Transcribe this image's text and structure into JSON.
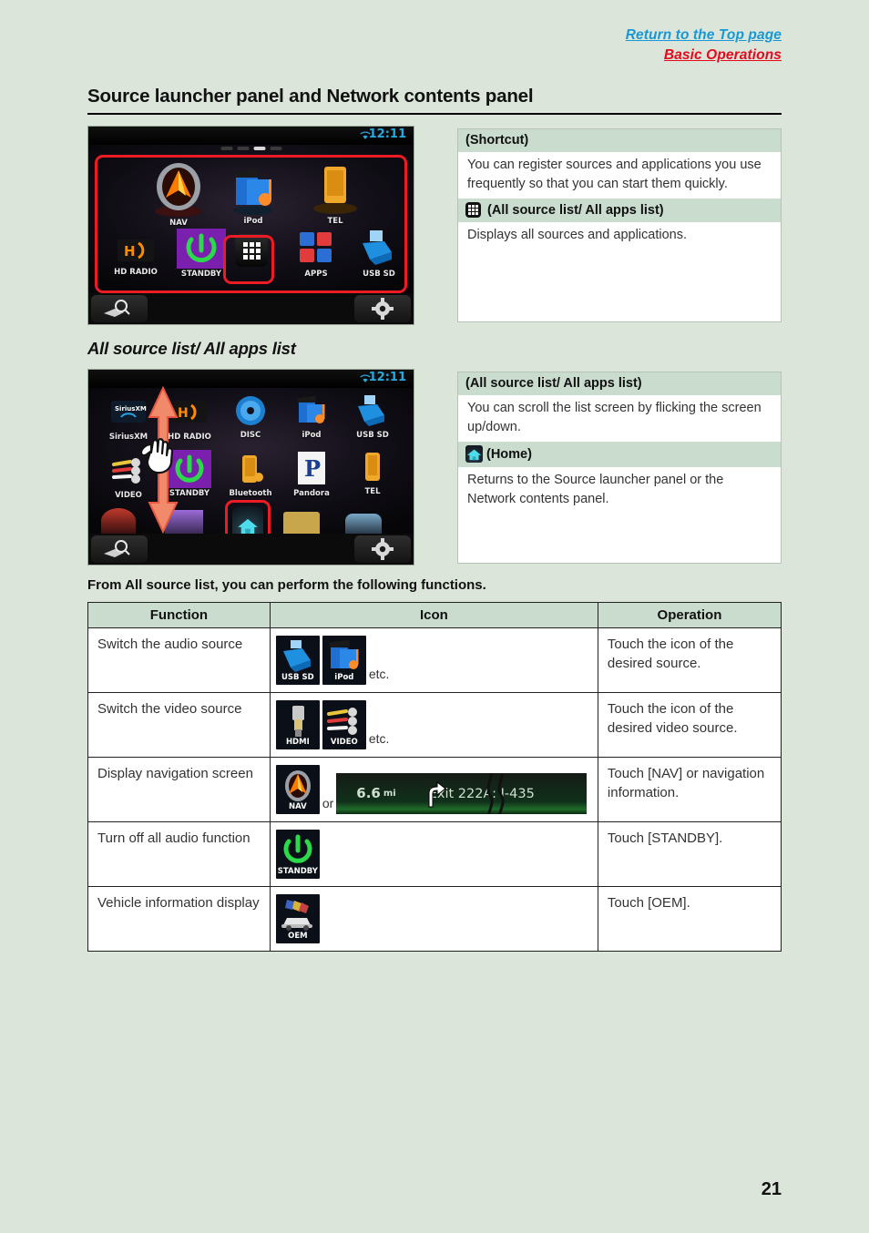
{
  "top_links": {
    "return": "Return to the Top page",
    "section": "Basic Operations",
    "return_color": "#1898d5",
    "section_color": "#e8071b"
  },
  "headings": {
    "main": "Source launcher panel and Network contents panel",
    "sub": "All source list/ All apps list",
    "table_intro": "From All source list, you can perform the following functions."
  },
  "device_launcher": {
    "clock": "12:11",
    "icons_row1": [
      {
        "label": "NAV",
        "icon": "nav-icon"
      },
      {
        "label": "iPod",
        "icon": "ipod-icon"
      },
      {
        "label": "TEL",
        "icon": "tel-icon"
      }
    ],
    "icons_row2": [
      {
        "label": "HD RADIO",
        "icon": "hd-radio-icon"
      },
      {
        "label": "STANDBY",
        "icon": "standby-icon"
      },
      {
        "label": "",
        "icon": "all-apps-grid-icon"
      },
      {
        "label": "APPS",
        "icon": "apps-icon"
      },
      {
        "label": "USB SD",
        "icon": "usb-sd-icon"
      }
    ],
    "bottom_left_icon": "map-search-icon",
    "bottom_right_icon": "gear-icon"
  },
  "device_allsource": {
    "clock": "12:11",
    "icons_row1": [
      {
        "label": "SiriusXM",
        "icon": "siriusxm-icon"
      },
      {
        "label": "HD RADIO",
        "icon": "hd-radio-icon"
      },
      {
        "label": "DISC",
        "icon": "disc-icon"
      },
      {
        "label": "iPod",
        "icon": "ipod-icon"
      },
      {
        "label": "USB SD",
        "icon": "usb-sd-icon"
      }
    ],
    "icons_row2": [
      {
        "label": "VIDEO",
        "icon": "video-icon"
      },
      {
        "label": "STANDBY",
        "icon": "standby-icon"
      },
      {
        "label": "Bluetooth",
        "icon": "bluetooth-icon"
      },
      {
        "label": "Pandora",
        "icon": "pandora-icon"
      },
      {
        "label": "TEL",
        "icon": "tel-icon"
      }
    ],
    "home_icon": "home-icon",
    "bottom_left_icon": "map-search-icon",
    "bottom_right_icon": "gear-icon"
  },
  "panel_shortcut": {
    "title": "(Shortcut)",
    "text": "You can register sources and applications you use frequently so that you can start them quickly.",
    "sub_title": "(All source list/ All apps list)",
    "sub_icon": "all-apps-grid-icon",
    "sub_text": "Displays all sources and applications."
  },
  "panel_allsource": {
    "title": " (All source list/ All apps list)",
    "text": "You can scroll the list screen by flicking the screen up/down.",
    "sub_title": "(Home)",
    "sub_icon": "home-icon",
    "sub_text": "Returns to the Source launcher panel or the Network contents panel."
  },
  "table": {
    "headers": [
      "Function",
      "Icon",
      "Operation"
    ],
    "rows": [
      {
        "function": "Switch the audio source",
        "icons": [
          {
            "label": "USB SD",
            "icon": "usb-sd-icon"
          },
          {
            "label": "iPod",
            "icon": "ipod-icon"
          }
        ],
        "etc": "etc.",
        "operation": "Touch the icon of the desired source."
      },
      {
        "function": "Switch the video source",
        "icons": [
          {
            "label": "HDMI",
            "icon": "hdmi-icon"
          },
          {
            "label": "VIDEO",
            "icon": "video-icon"
          }
        ],
        "etc": "etc.",
        "operation": "Touch the icon of the desired video source."
      },
      {
        "function": "Display navigation screen",
        "icons": [
          {
            "label": "NAV",
            "icon": "nav-icon"
          }
        ],
        "etc": "or",
        "nav_strip": {
          "distance": "6.6",
          "unit": "mi",
          "exit": "Exit 222A: I-435",
          "turn_icon": "turn-right-arrow-icon"
        },
        "operation": "Touch [NAV] or navigation information."
      },
      {
        "function": "Turn off all audio function",
        "icons": [
          {
            "label": "STANDBY",
            "icon": "standby-icon"
          }
        ],
        "etc": "",
        "operation": "Touch [STANDBY]."
      },
      {
        "function": "Vehicle information display",
        "icons": [
          {
            "label": "OEM",
            "icon": "oem-icon"
          }
        ],
        "etc": "",
        "operation": "Touch [OEM]."
      }
    ]
  },
  "page_number": "21",
  "colors": {
    "page_background": "#dbe5da",
    "band": "#c9dcce",
    "highlight": "#ed1c24",
    "accent_blue": "#27a9e1"
  }
}
